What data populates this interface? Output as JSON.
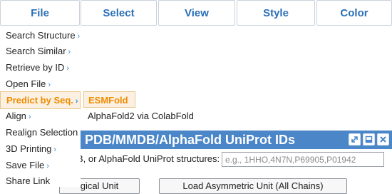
{
  "menubar": {
    "items": [
      "File",
      "Select",
      "View",
      "Style",
      "Color"
    ]
  },
  "file_menu": {
    "items": [
      {
        "label": "Search Structure",
        "arrow": "›"
      },
      {
        "label": "Search Similar",
        "arrow": "›"
      },
      {
        "label": "Retrieve by ID",
        "arrow": "›"
      },
      {
        "label": "Open File",
        "arrow": "›"
      },
      {
        "label": "Predict by Seq.",
        "arrow": "›"
      },
      {
        "label": "Align",
        "arrow": "›"
      },
      {
        "label": "Realign Selection",
        "arrow": "›"
      },
      {
        "label": "3D Printing",
        "arrow": "›"
      },
      {
        "label": "Save File",
        "arrow": "›"
      },
      {
        "label": "Share Link",
        "arrow": ""
      }
    ],
    "active_index": 4
  },
  "predict_submenu": {
    "items": [
      "ESMFold",
      "AlphaFold2 via ColabFold"
    ]
  },
  "dialog": {
    "title": "PDB/MMDB/AlphaFold UniProt IDs",
    "prompt_text": "B, or AlphaFold UniProt structures:",
    "input_placeholder": "e.g., 1HHO,4N7N,P69905,P01942",
    "button_left": "gical Unit",
    "button_right": "Load Asymmetric Unit (All Chains)"
  },
  "colors": {
    "accent": "#4a86c8",
    "menu_text_blue": "#2a6fb8",
    "active_orange": "#f08c00"
  }
}
